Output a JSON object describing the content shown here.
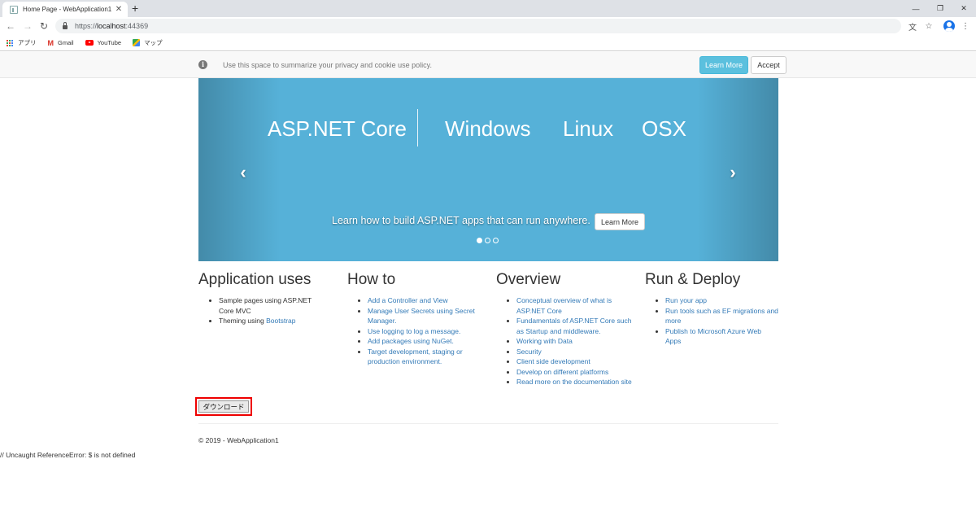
{
  "browser": {
    "tab_title": "Home Page - WebApplication1",
    "url_scheme": "https://",
    "url_host": "localhost",
    "url_port": ":44369",
    "bookmarks": [
      {
        "label": "アプリ",
        "icon": "apps-icon"
      },
      {
        "label": "Gmail",
        "icon": "gmail-icon"
      },
      {
        "label": "YouTube",
        "icon": "youtube-icon"
      },
      {
        "label": "マップ",
        "icon": "maps-icon"
      }
    ]
  },
  "cookie": {
    "text": "Use this space to summarize your privacy and cookie use policy.",
    "learn_more": "Learn More",
    "accept": "Accept"
  },
  "carousel": {
    "banner_words": [
      "ASP.NET Core",
      "Windows",
      "Linux",
      "OSX"
    ],
    "caption": "Learn how to build ASP.NET apps that can run anywhere.",
    "caption_button": "Learn More",
    "slide_count": 3,
    "active_slide": 1,
    "background_color": "#56b1d8"
  },
  "columns": [
    {
      "title": "Application uses",
      "items": [
        {
          "text": "Sample pages using ASP.NET Core MVC",
          "link": false
        },
        {
          "text": "Theming using ",
          "link_text": "Bootstrap",
          "link": "partial"
        }
      ]
    },
    {
      "title": "How to",
      "items": [
        {
          "text": "Add a Controller and View",
          "link": true
        },
        {
          "text": "Manage User Secrets using Secret Manager.",
          "link": true
        },
        {
          "text": "Use logging to log a message.",
          "link": true
        },
        {
          "text": "Add packages using NuGet.",
          "link": true
        },
        {
          "text": "Target development, staging or production environment.",
          "link": true
        }
      ]
    },
    {
      "title": "Overview",
      "items": [
        {
          "text": "Conceptual overview of what is ASP.NET Core",
          "link": true
        },
        {
          "text": "Fundamentals of ASP.NET Core such as Startup and middleware.",
          "link": true
        },
        {
          "text": "Working with Data",
          "link": true
        },
        {
          "text": "Security",
          "link": true
        },
        {
          "text": "Client side development",
          "link": true
        },
        {
          "text": "Develop on different platforms",
          "link": true
        },
        {
          "text": "Read more on the documentation site",
          "link": true
        }
      ]
    },
    {
      "title": "Run & Deploy",
      "items": [
        {
          "text": "Run your app",
          "link": true
        },
        {
          "text": "Run tools such as EF migrations and more",
          "link": true
        },
        {
          "text": "Publish to Microsoft Azure Web Apps",
          "link": true
        }
      ]
    }
  ],
  "download_button": "ダウンロード",
  "footer": "© 2019 - WebApplication1",
  "console_output": "// Uncaught ReferenceError: $ is not defined",
  "colors": {
    "link": "#337ab7",
    "info_button": "#5bc0de",
    "highlight_border": "#e00000"
  }
}
